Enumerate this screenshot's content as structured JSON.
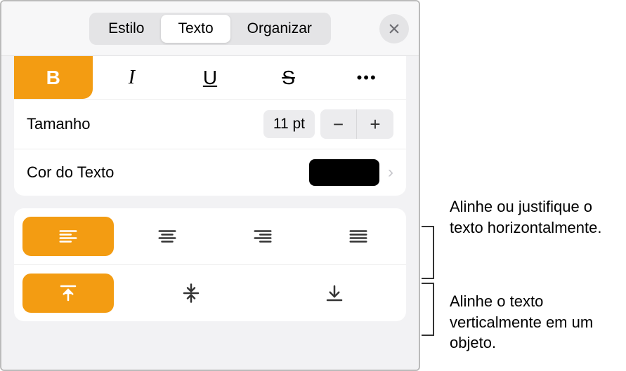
{
  "tabs": {
    "style": "Estilo",
    "text": "Texto",
    "arrange": "Organizar"
  },
  "format": {
    "bold": "B",
    "italic": "I",
    "underline": "U",
    "strike": "S",
    "more": "•••"
  },
  "size": {
    "label": "Tamanho",
    "value": "11 pt",
    "minus": "−",
    "plus": "+"
  },
  "textColor": {
    "label": "Cor do Texto",
    "hex": "#000000"
  },
  "callouts": {
    "horizontal": "Alinhe ou justifique o texto horizontalmente.",
    "vertical": "Alinhe o texto verticalmente em um objeto."
  }
}
